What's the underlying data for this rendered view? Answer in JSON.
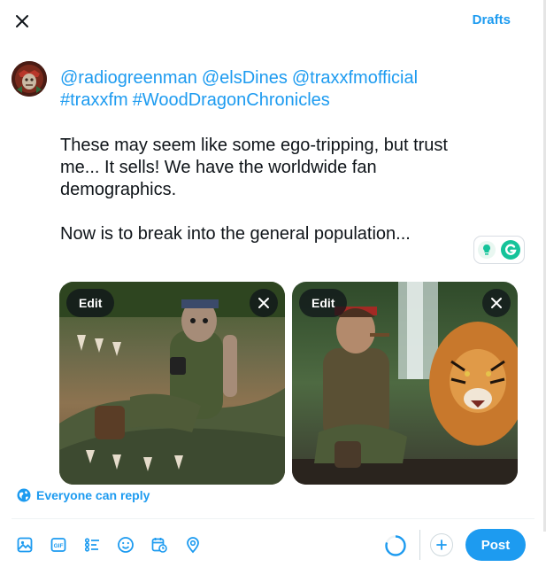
{
  "header": {
    "close_icon": "close-icon",
    "drafts_label": "Drafts"
  },
  "composer": {
    "avatar_icon": "avatar",
    "mentions": [
      "@radiogreenman",
      "@elsDines",
      "@traxxfmofficial",
      "#traxxfm",
      "#WoodDragonChronicles"
    ],
    "paragraph_1": "These may seem like some ego-tripping, but trust me...  It sells!  We have the worldwide fan demographics.",
    "paragraph_2": "Now is to break into the general population..."
  },
  "media": [
    {
      "edit_label": "Edit",
      "remove_icon": "close-icon"
    },
    {
      "edit_label": "Edit",
      "remove_icon": "close-icon"
    }
  ],
  "reply_setting": {
    "icon": "globe-icon",
    "label": "Everyone can reply"
  },
  "toolbar": {
    "icons": [
      "image-icon",
      "gif-icon",
      "poll-icon",
      "emoji-icon",
      "schedule-icon",
      "location-icon"
    ]
  },
  "footer": {
    "progress_icon": "character-count-ring",
    "progress_fraction": 0.8,
    "add_icon": "plus-icon",
    "post_label": "Post"
  },
  "colors": {
    "accent": "#1d9bf0",
    "text": "#0f1419",
    "border": "#cfd9de"
  }
}
